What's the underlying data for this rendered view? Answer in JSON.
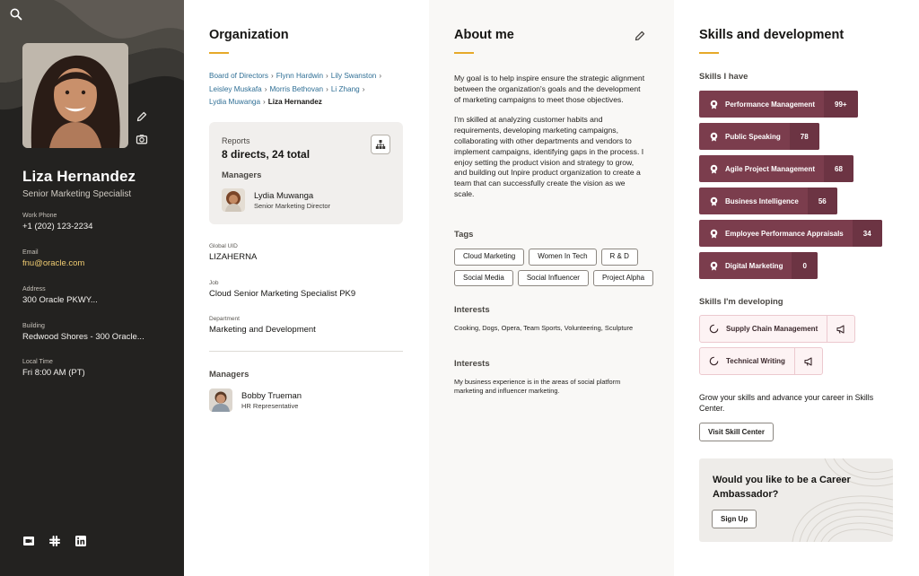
{
  "profile": {
    "name": "Liza Hernandez",
    "title": "Senior Marketing Specialist",
    "fields": [
      {
        "label": "Work Phone",
        "value": "+1 (202) 123-2234"
      },
      {
        "label": "Email",
        "value": "fnu@oracle.com"
      },
      {
        "label": "Address",
        "value": "300 Oracle PKWY..."
      },
      {
        "label": "Building",
        "value": "Redwood Shores - 300 Oracle..."
      },
      {
        "label": "Local Time",
        "value": "Fri 8:00 AM (PT)"
      }
    ],
    "icons": {
      "search": "search-icon",
      "edit": "pencil-icon",
      "camera": "camera-icon",
      "socials": [
        "video-chat-icon",
        "slack-icon",
        "linkedin-icon"
      ]
    }
  },
  "organization": {
    "title": "Organization",
    "breadcrumb": [
      "Board of Directors",
      "Flynn Hardwin",
      "Lily Swanston",
      "Leisley Muskafa",
      "Morris Bethovan",
      "Li Zhang",
      "Lydia Muwanga",
      "Liza Hernandez"
    ],
    "reports_label": "Reports",
    "reports_value": "8 directs, 24 total",
    "managers_label": "Managers",
    "card_manager": {
      "name": "Lydia Muwanga",
      "role": "Senior Marketing Director"
    },
    "global_uid_label": "Global UID",
    "global_uid": "LIZAHERNA",
    "job_label": "Job",
    "job": "Cloud Senior Marketing Specialist PK9",
    "department_label": "Department",
    "department": "Marketing and Development",
    "managers_title": "Managers",
    "bottom_manager": {
      "name": "Bobby Trueman",
      "role": "HR Representative"
    }
  },
  "about": {
    "title": "About me",
    "paragraphs": [
      "My goal is to help inspire ensure the strategic alignment between the organization's goals and the development of marketing campaigns to meet those objectives.",
      "I'm skilled at analyzing customer habits and requirements, developing marketing campaigns, collaborating with other departments and vendors to implement campaigns, identifying gaps in the process. I enjoy setting the product vision and strategy to grow, and building out Inpire product organization to create a team that can successfully create the vision as we scale."
    ],
    "tags_title": "Tags",
    "tags": [
      "Cloud Marketing",
      "Women In Tech",
      "R & D",
      "Social Media",
      "Social Influencer",
      "Project Alpha"
    ],
    "interests_title": "Interests",
    "interests": "Cooking, Dogs, Opera, Team Sports, Volunteering, Sculpture",
    "interests2_title": "Interests",
    "interests2": "My business experience is in the areas of social platform marketing and influencer marketing."
  },
  "skills": {
    "title": "Skills and development",
    "have_title": "Skills I have",
    "have": [
      {
        "name": "Performance Management",
        "count": "99+"
      },
      {
        "name": "Public Speaking",
        "count": "78"
      },
      {
        "name": "Agile Project Management",
        "count": "68"
      },
      {
        "name": "Business Intelligence",
        "count": "56"
      },
      {
        "name": "Employee Performance Appraisals",
        "count": "34"
      },
      {
        "name": "Digital Marketing",
        "count": "0"
      }
    ],
    "developing_title": "Skills I'm developing",
    "developing": [
      {
        "name": "Supply Chain Management"
      },
      {
        "name": "Technical Writing"
      }
    ],
    "grow_text": "Grow your skills and advance your career in Skills Center.",
    "visit_button": "Visit Skill Center",
    "ambassador_title": "Would you like to be a Career Ambassador?",
    "signup_button": "Sign Up"
  },
  "colors": {
    "skill_bg": "#7b3d4d",
    "accent_underline": "#e6a929",
    "email_link": "#f0cc71",
    "sidebar_bg": "#232220"
  }
}
